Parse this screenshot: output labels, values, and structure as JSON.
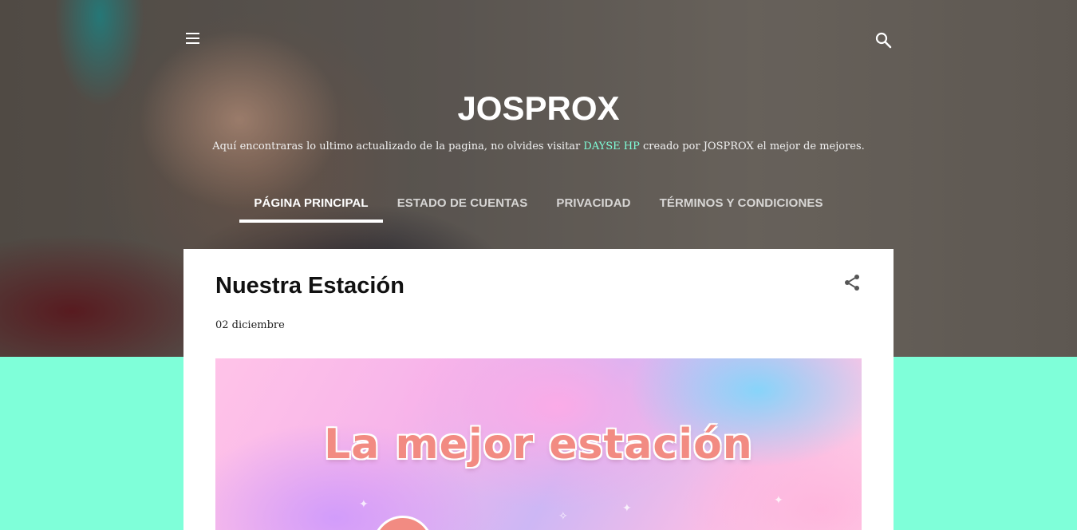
{
  "header": {
    "menu_icon": "hamburger-menu-icon",
    "search_icon": "search-icon",
    "title": "JOSPROX",
    "description_before": "Aquí encontraras lo ultimo actualizado de la pagina, no olvides visitar ",
    "description_link": "DAYSE HP",
    "description_after": " creado por JOSPROX el mejor de mejores.",
    "link_color": "#7fffd9"
  },
  "nav": {
    "items": [
      {
        "label": "PÁGINA PRINCIPAL",
        "active": true
      },
      {
        "label": "ESTADO DE CUENTAS",
        "active": false
      },
      {
        "label": "PRIVACIDAD",
        "active": false
      },
      {
        "label": "TÉRMINOS Y CONDICIONES",
        "active": false
      }
    ]
  },
  "post": {
    "title": "Nuestra Estación",
    "date": "02 diciembre",
    "share_icon": "share-icon",
    "image_text": "La mejor estación"
  },
  "colors": {
    "background_accent": "#7fffd9",
    "card": "#ffffff",
    "image_text": "#f28b82"
  }
}
